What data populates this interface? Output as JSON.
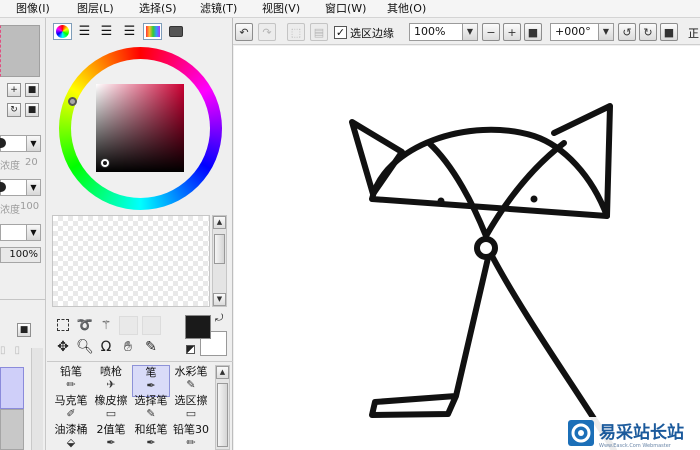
{
  "menu": {
    "items": [
      {
        "label": "图像(I)"
      },
      {
        "label": "图层(L)"
      },
      {
        "label": "选择(S)"
      },
      {
        "label": "滤镜(T)"
      },
      {
        "label": "视图(V)"
      },
      {
        "label": "窗口(W)"
      },
      {
        "label": "其他(O)"
      }
    ]
  },
  "toolbar": {
    "selection_edge_checkbox": {
      "label": "选区边缘",
      "checked": true
    },
    "zoom": {
      "value": "100%"
    },
    "rotation": {
      "value": "+000°"
    },
    "last_label": "正"
  },
  "left_strip": {
    "density_label_1": "浓度",
    "density_value_1": "20",
    "density_label_2": "浓度",
    "density_value_2": "100",
    "opacity_value": "100%"
  },
  "brushes": [
    {
      "label": "铅笔",
      "icon": "pencil-icon"
    },
    {
      "label": "喷枪",
      "icon": "airbrush-icon"
    },
    {
      "label": "笔",
      "icon": "pen-icon",
      "selected": true
    },
    {
      "label": "水彩笔",
      "icon": "watercolor-icon"
    },
    {
      "label": "马克笔",
      "icon": "marker-icon"
    },
    {
      "label": "橡皮擦",
      "icon": "eraser-icon"
    },
    {
      "label": "选择笔",
      "icon": "select-pen-icon"
    },
    {
      "label": "选区擦",
      "icon": "select-eraser-icon"
    },
    {
      "label": "油漆桶",
      "icon": "bucket-icon"
    },
    {
      "label": "2值笔",
      "icon": "binary-pen-icon"
    },
    {
      "label": "和纸笔",
      "icon": "washi-pen-icon"
    },
    {
      "label": "铅笔30",
      "icon": "pencil30-icon"
    }
  ],
  "colors": {
    "foreground": "#1a1a1a",
    "background": "#ffffff"
  },
  "watermark": {
    "text": "易采站长站",
    "sub": "Www.Easck.Com Webmaster"
  }
}
